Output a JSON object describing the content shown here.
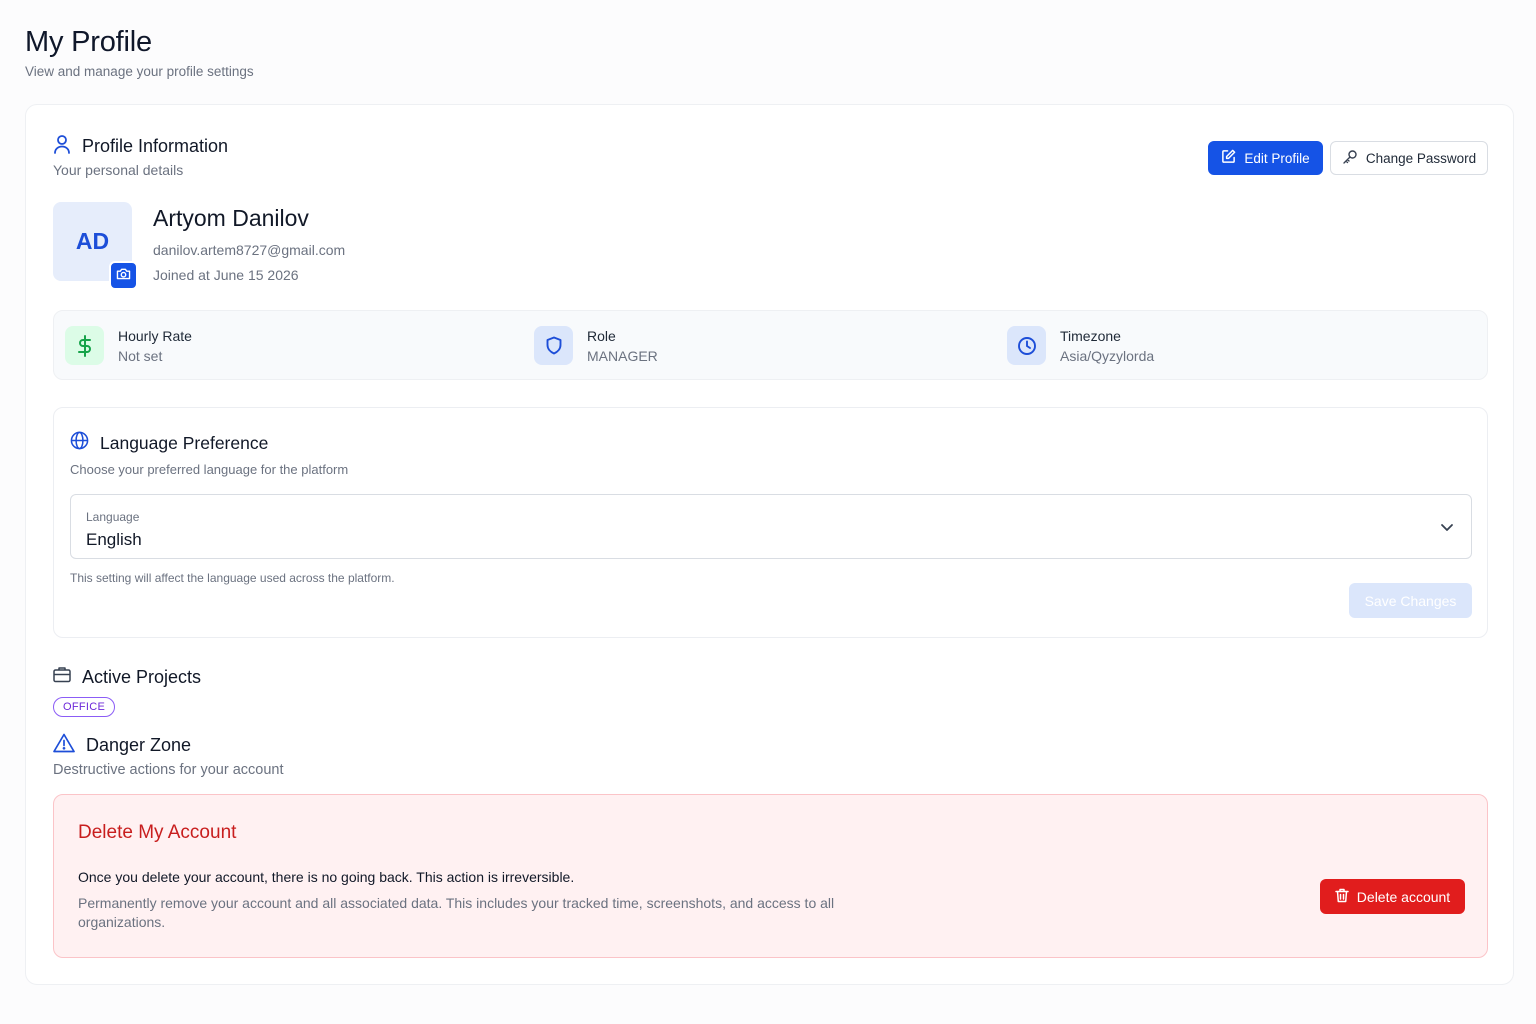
{
  "page": {
    "title": "My Profile",
    "subtitle": "View and manage your profile settings"
  },
  "profile_info": {
    "title": "Profile Information",
    "description": "Your personal details",
    "edit_label": "Edit Profile",
    "change_password_label": "Change Password",
    "icon": "user-icon"
  },
  "user": {
    "initials": "AD",
    "name": "Artyom Danilov",
    "email": "danilov.artem8727@gmail.com",
    "joined": "Joined at June 15 2026"
  },
  "stats": [
    {
      "label": "Hourly Rate",
      "value": "Not set",
      "icon": "dollar-icon",
      "color": "#16a34a"
    },
    {
      "label": "Role",
      "value": "MANAGER",
      "icon": "shield-icon",
      "color": "#1d4ed8"
    },
    {
      "label": "Timezone",
      "value": "Asia/Qyzylorda",
      "icon": "clock-icon",
      "color": "#1d4ed8"
    }
  ],
  "language": {
    "title": "Language Preference",
    "description": "Choose your preferred language for the platform",
    "field_label": "Language",
    "selected": "English",
    "helper": "This setting will affect the language used across the platform.",
    "save_label": "Save Changes"
  },
  "projects": {
    "title": "Active Projects",
    "tags": [
      "OFFICE"
    ]
  },
  "danger": {
    "title": "Danger Zone",
    "description": "Destructive actions for your account",
    "box_title": "Delete My Account",
    "warning": "Once you delete your account, there is no going back. This action is irreversible.",
    "details": "Permanently remove your account and all associated data. This includes your tracked time, screenshots, and access to all organizations.",
    "delete_label": "Delete account"
  },
  "colors": {
    "primary": "#1553e6",
    "danger": "#e11d1d",
    "tag": "#7c3aed"
  }
}
